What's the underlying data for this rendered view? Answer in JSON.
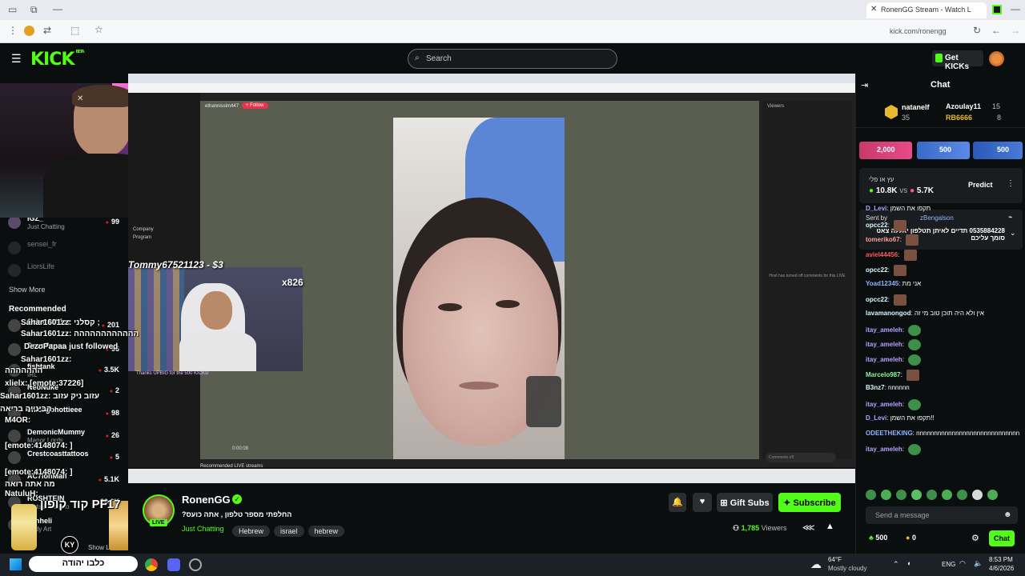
{
  "browser": {
    "tab_title": "RonenGG Stream - Watch L",
    "url": "kick.com/ronengg"
  },
  "header": {
    "logo": "KICK",
    "logo_badge": "BETA",
    "search_placeholder": "Search",
    "get_kicks": "Get KICKs"
  },
  "sidebar": {
    "following": [
      {
        "name": "IGZ_",
        "category": "Just Chatting",
        "viewers": "99"
      },
      {
        "name": "sensei_fr",
        "category": "",
        "viewers": ""
      },
      {
        "name": "LiorsLife",
        "category": "",
        "viewers": ""
      }
    ],
    "show_more": "Show More",
    "recommended_title": "Recommended",
    "recommended": [
      {
        "name": "Sahar1601zz",
        "category": "",
        "viewers": "201"
      },
      {
        "name": "DezoPapaa",
        "category": "",
        "viewers": "96"
      },
      {
        "name": "fishtank",
        "category": "IRL",
        "viewers": "3.5K"
      },
      {
        "name": "NeoNuke",
        "category": "",
        "viewers": "2"
      },
      {
        "name": "chicagohottieee",
        "category": "",
        "viewers": "98"
      },
      {
        "name": "DemonicMummy",
        "category": "Manor Lords",
        "viewers": "26"
      },
      {
        "name": "Crestcoasttattoos",
        "category": "",
        "viewers": "5"
      },
      {
        "name": "AC7ionMan",
        "category": "",
        "viewers": "5.1K"
      },
      {
        "name": "ROSHTEIN",
        "category": "Slots & Casino",
        "viewers": "20.6K"
      },
      {
        "name": "vanheli",
        "category": "Body Art",
        "viewers": ""
      }
    ],
    "show_less": "Show Less"
  },
  "overlay": {
    "donation_text": "Tommy67521123 - $3",
    "combo": "x826",
    "chat_overlay_lines": [
      "Sahar1601zz: קסלני ;",
      "Sahar1601zz: הההההההההההה",
      "DezoPapaa just followed",
      "Sahar1601zz:",
      "ההההההה",
      "xlielx: [emote:37226]",
      "Sahar1601zz: עזוב ניק עזוב",
      "הבינייה בריאה",
      "M4OR:",
      "[emote:4148074: ]",
      "[emote:4148074: ]",
      "מה אתה רואה",
      "NatuluH:"
    ],
    "perfume_ad": "קוד קופון PF17",
    "perfume_brand": "KY",
    "perfume_site": "כלבו יהודה"
  },
  "stream": {
    "streamer": "RonenGG",
    "title": "?החלפתי מספר טלפון , אתה כועס",
    "category": "Just Chatting",
    "tags": [
      "Hebrew",
      "israel",
      "hebrew"
    ],
    "viewers": "1,785",
    "viewers_label": "Viewers",
    "live_badge": "LIVE",
    "gift_subs": "Gift Subs",
    "subscribe": "Subscribe",
    "inner_page": {
      "username": "ethannissim447",
      "follow": "+ Follow",
      "viewers_panel": "Viewers",
      "comments_off": "Host has turned off comments for this LIVE",
      "comments_box": "Comments off",
      "recommended": "Recommended LIVE streams",
      "company": "Company",
      "program": "Program",
      "donation_thanks": "Thanks UPBIG for the 500 KICKs!",
      "time": "0:00:08"
    }
  },
  "chat": {
    "title": "Chat",
    "leaderboard": [
      {
        "name": "natanelf",
        "value": "35"
      },
      {
        "name": "Azoulay11",
        "value": "15"
      },
      {
        "name": "RB6666",
        "value": "8"
      }
    ],
    "kicks_bar": [
      "2,000",
      "500",
      "500"
    ],
    "prediction": {
      "question": "עץ או פלי",
      "a": "10.8K",
      "vs": "vs",
      "b": "5.7K",
      "button": "Predict"
    },
    "pinned": {
      "sent_by": "Sent by",
      "user": "zBengalson",
      "message": "0535884228 תדיים לאיתן תטלפון יאללה צאט סומך עליכם"
    },
    "messages": [
      {
        "user": "D_Levi",
        "text": "תקפו את השמן",
        "color": "#b7a0ff",
        "emote": ""
      },
      {
        "user": "opcc22",
        "text": "",
        "color": "#d7f9ff",
        "emote": "e"
      },
      {
        "user": "tomeriko67",
        "text": "",
        "color": "#ff9c9c",
        "emote": "e"
      },
      {
        "user": "aviel44456",
        "text": "",
        "color": "#ff5c5c",
        "emote": "e"
      },
      {
        "user": "opcc22",
        "text": "",
        "color": "#d7f9ff",
        "emote": "e"
      },
      {
        "user": "Yoad12345",
        "text": "אני מת",
        "color": "#8fb4ff",
        "emote": ""
      },
      {
        "user": "opcc22",
        "text": "",
        "color": "#d7f9ff",
        "emote": "e"
      },
      {
        "user": "lavamanongod",
        "text": "אין ולא היה תוכן טוב מי זה",
        "color": "#d7f9ff",
        "emote": ""
      },
      {
        "user": "itay_ameleh",
        "text": "",
        "color": "#b7a0ff",
        "emote": "g"
      },
      {
        "user": "itay_ameleh",
        "text": "",
        "color": "#b7a0ff",
        "emote": "g"
      },
      {
        "user": "itay_ameleh",
        "text": "",
        "color": "#b7a0ff",
        "emote": "g"
      },
      {
        "user": "Marcelo987",
        "text": "",
        "color": "#86f99c",
        "emote": "e"
      },
      {
        "user": "B3nz7",
        "text": "nnnnnn",
        "color": "#d7f9ff",
        "emote": ""
      },
      {
        "user": "itay_ameleh",
        "text": "",
        "color": "#b7a0ff",
        "emote": "g"
      },
      {
        "user": "D_Levi",
        "text": "תקפו את השמן!!",
        "color": "#b7a0ff",
        "emote": ""
      },
      {
        "user": "ODEETHEKING",
        "text": "nnnnnnnnnnnnnnnnnnnnnnnnnnnnn",
        "color": "#8fb4ff",
        "emote": ""
      },
      {
        "user": "itay_ameleh",
        "text": "",
        "color": "#b7a0ff",
        "emote": "g"
      }
    ],
    "input_placeholder": "Send a message",
    "kicks_balance": "500",
    "points": "0",
    "send": "Chat"
  },
  "taskbar": {
    "weather_temp": "64°F",
    "weather_desc": "Mostly cloudy",
    "lang": "ENG",
    "time": "8:53 PM",
    "date": "4/6/2026"
  },
  "colors": {
    "brand": "#53fc18",
    "bg": "#0b0e0f"
  }
}
